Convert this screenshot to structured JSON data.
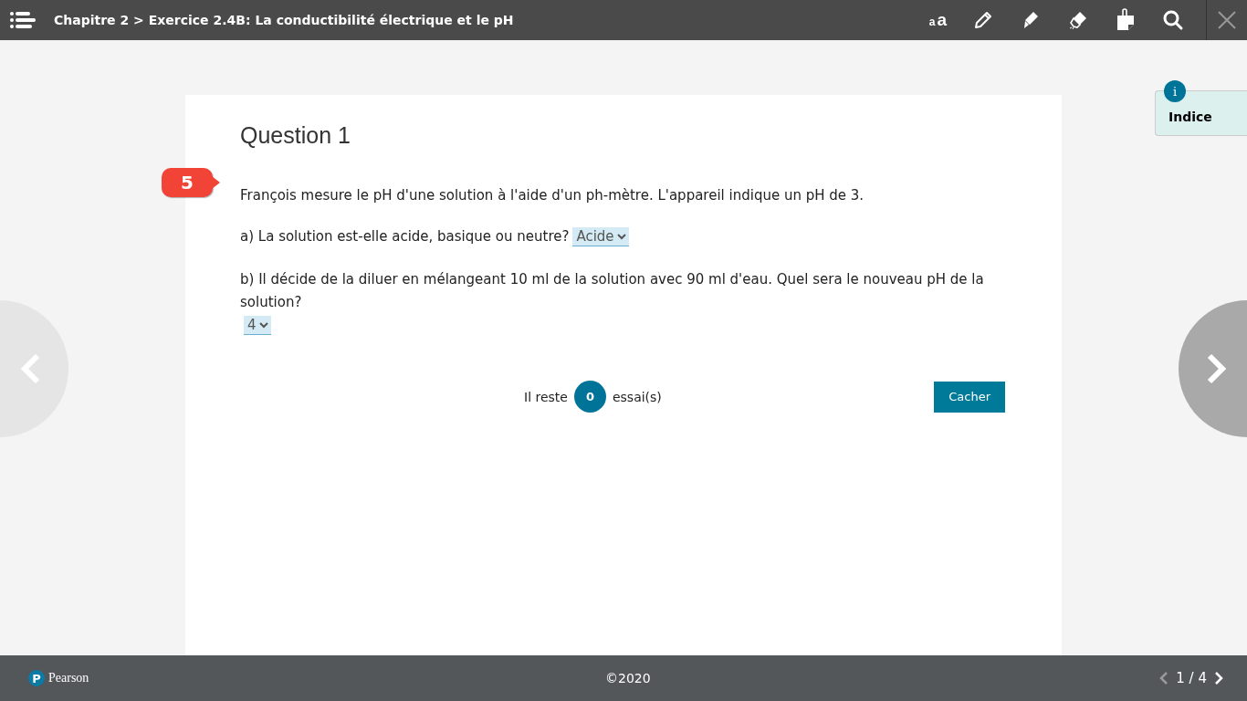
{
  "header": {
    "title": "Chapitre 2 > Exercice 2.4B: La conductibilité électrique et le pH",
    "font_size_tool": [
      "a",
      "a"
    ]
  },
  "hint_tab": {
    "icon_text": "i",
    "label": "Indice"
  },
  "question": {
    "title": "Question 1",
    "badge": "5",
    "statement": "François mesure le pH d'une solution à l'aide d'un ph-mètre. L'appareil indique un pH de 3.",
    "parts": [
      {
        "text": "a) La solution est-elle acide, basique ou neutre?",
        "value": "Acide"
      },
      {
        "text": "b) Il décide de la diluer en mélangeant 10 ml de la solution avec 90 ml d'eau. Quel sera le nouveau pH de la solution?",
        "value": "4"
      }
    ],
    "attempts_before": "Il reste",
    "attempts_count": "0",
    "attempts_after": "essai(s)",
    "hide_button": "Cacher"
  },
  "footer": {
    "logo_mark": "P",
    "logo_text": "Pearson",
    "copyright": "©2020",
    "page": "1 / 4",
    "page_prev_disabled": true,
    "page_next_disabled": false
  }
}
